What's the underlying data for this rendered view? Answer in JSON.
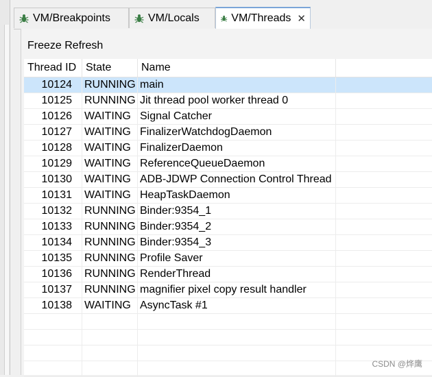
{
  "tabs": [
    {
      "label": "VM/Breakpoints",
      "icon": "bug-icon",
      "active": false
    },
    {
      "label": "VM/Locals",
      "icon": "bug-icon",
      "active": false
    },
    {
      "label": "VM/Threads",
      "icon": "bug-icon",
      "active": true,
      "close": "✕"
    }
  ],
  "toolbar": {
    "label": "Freeze Refresh"
  },
  "table": {
    "columns": [
      "Thread ID",
      "State",
      "Name"
    ],
    "rows": [
      {
        "id": "10124",
        "state": "RUNNING",
        "name": "main"
      },
      {
        "id": "10125",
        "state": "RUNNING",
        "name": "Jit thread pool worker thread 0"
      },
      {
        "id": "10126",
        "state": "WAITING",
        "name": "Signal Catcher"
      },
      {
        "id": "10127",
        "state": "WAITING",
        "name": "FinalizerWatchdogDaemon"
      },
      {
        "id": "10128",
        "state": "WAITING",
        "name": "FinalizerDaemon"
      },
      {
        "id": "10129",
        "state": "WAITING",
        "name": "ReferenceQueueDaemon"
      },
      {
        "id": "10130",
        "state": "WAITING",
        "name": "ADB-JDWP Connection Control Thread"
      },
      {
        "id": "10131",
        "state": "WAITING",
        "name": "HeapTaskDaemon"
      },
      {
        "id": "10132",
        "state": "RUNNING",
        "name": "Binder:9354_1"
      },
      {
        "id": "10133",
        "state": "RUNNING",
        "name": "Binder:9354_2"
      },
      {
        "id": "10134",
        "state": "RUNNING",
        "name": "Binder:9354_3"
      },
      {
        "id": "10135",
        "state": "RUNNING",
        "name": "Profile Saver"
      },
      {
        "id": "10136",
        "state": "RUNNING",
        "name": "RenderThread"
      },
      {
        "id": "10137",
        "state": "RUNNING",
        "name": "magnifier pixel copy result handler"
      },
      {
        "id": "10138",
        "state": "WAITING",
        "name": "AsyncTask #1"
      }
    ],
    "selected_row": 0,
    "selection_color": "#cce5fb"
  },
  "watermark": "CSDN @烨鹰"
}
